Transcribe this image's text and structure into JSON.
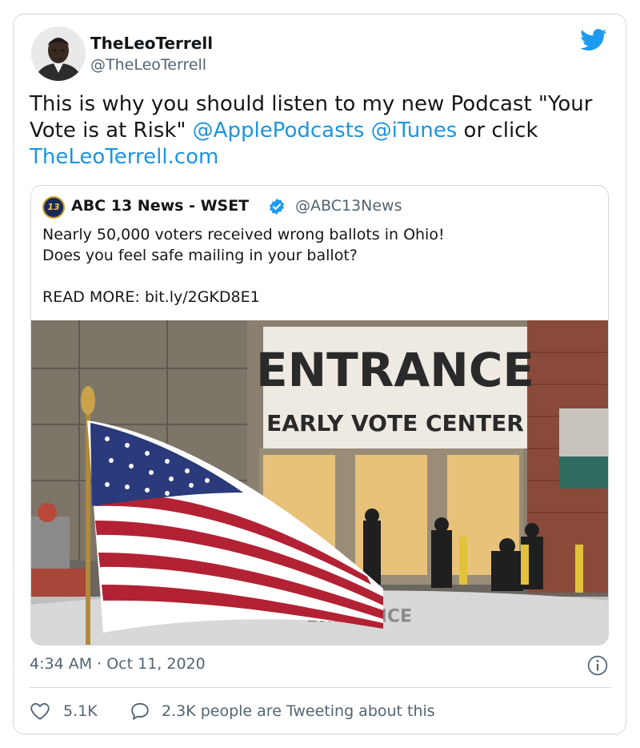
{
  "author": {
    "name": "TheLeoTerrell",
    "handle": "@TheLeoTerrell"
  },
  "tweet": {
    "text_1": "This is why you should listen to my new Podcast \"Your Vote is at Risk\" ",
    "mention_1": "@ApplePodcasts",
    "mention_2": "@iTunes",
    "text_2": " or click ",
    "link": "TheLeoTerrell.com"
  },
  "quoted": {
    "avatar_text": "13",
    "name": "ABC 13 News - WSET",
    "handle": "@ABC13News",
    "text": "Nearly 50,000 voters received wrong ballots in Ohio!\nDoes you feel safe mailing in your ballot?\n\nREAD MORE: bit.ly/2GKD8E1",
    "image": {
      "banner_line_1": "ENTRANCE",
      "banner_line_2": "EARLY VOTE CENTER",
      "windshield_text": "ENTRANCE"
    }
  },
  "meta": {
    "timestamp": "4:34 AM · Oct 11, 2020"
  },
  "actions": {
    "likes": "5.1K",
    "tweeting": "2.3K people are Tweeting about this"
  },
  "icons": {
    "twitter": "twitter-bird-icon",
    "verified": "verified-badge-icon",
    "info": "info-icon",
    "like": "heart-icon",
    "reply": "speech-bubble-icon"
  },
  "colors": {
    "link": "#1b95e0",
    "secondary_text": "#536471",
    "border": "#cfd9de",
    "twitter_blue": "#1d9bf0"
  }
}
